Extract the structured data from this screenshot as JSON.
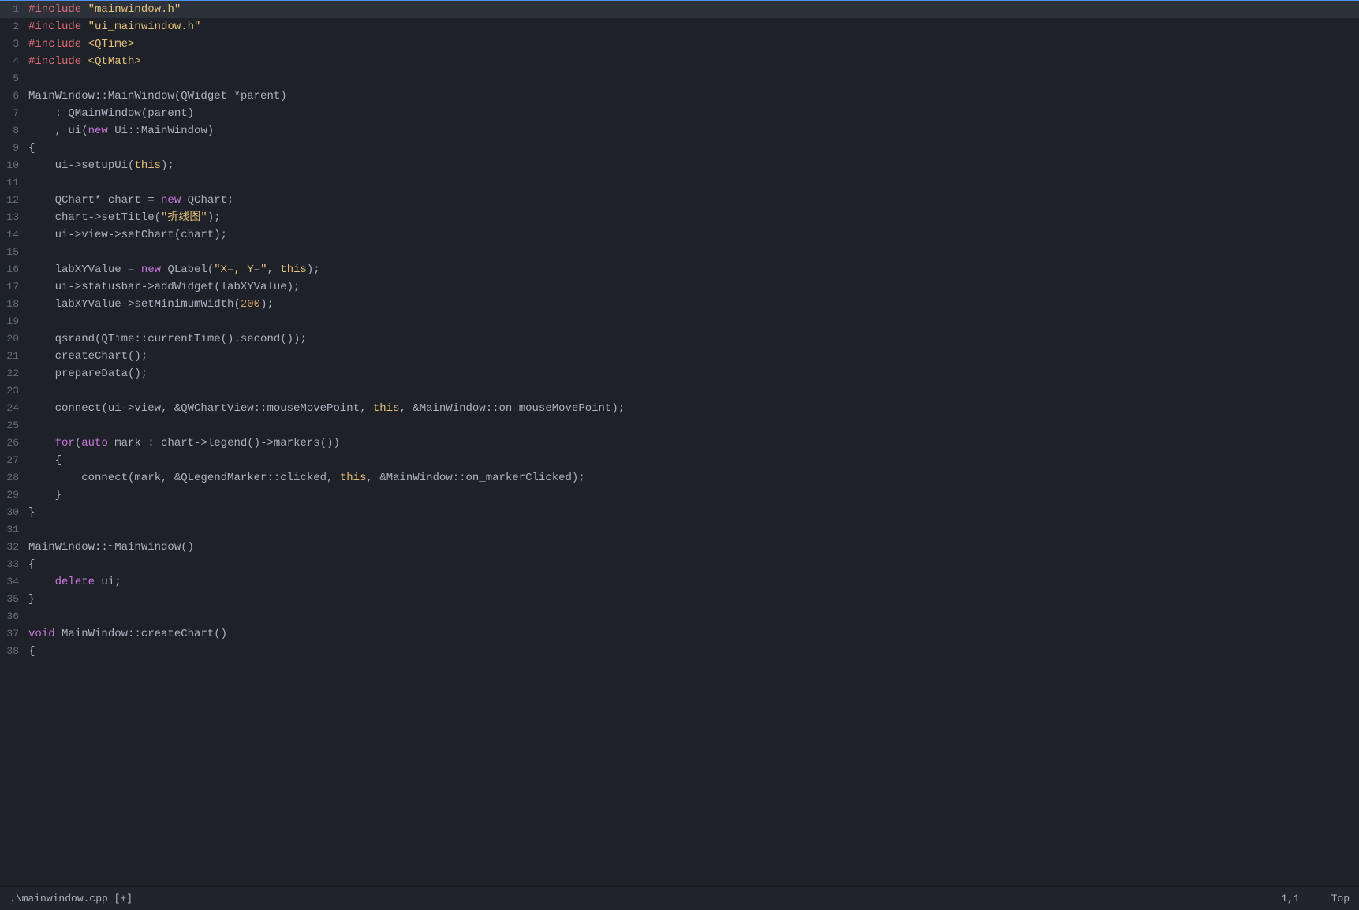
{
  "statusbar": {
    "filename": ".\\mainwindow.cpp [+]",
    "position": "1,1",
    "scroll": "Top"
  },
  "lines": [
    {
      "num": 1,
      "tokens": [
        {
          "t": "include",
          "c": "c-include"
        },
        {
          "t": " ",
          "c": ""
        },
        {
          "t": "\"mainwindow.h\"",
          "c": "c-string"
        }
      ]
    },
    {
      "num": 2,
      "tokens": [
        {
          "t": "#include",
          "c": "c-include"
        },
        {
          "t": " ",
          "c": ""
        },
        {
          "t": "\"ui_mainwindow.h\"",
          "c": "c-string"
        }
      ]
    },
    {
      "num": 3,
      "tokens": [
        {
          "t": "#include",
          "c": "c-include"
        },
        {
          "t": " ",
          "c": ""
        },
        {
          "t": "<QTime>",
          "c": "c-angle-string"
        }
      ]
    },
    {
      "num": 4,
      "tokens": [
        {
          "t": "#include",
          "c": "c-include"
        },
        {
          "t": " ",
          "c": ""
        },
        {
          "t": "<QtMath>",
          "c": "c-angle-string"
        }
      ]
    },
    {
      "num": 5,
      "tokens": []
    },
    {
      "num": 6,
      "tokens": [
        {
          "t": "MainWindow::MainWindow(QWidget *parent)",
          "c": ""
        }
      ]
    },
    {
      "num": 7,
      "tokens": [
        {
          "t": "    : QMainWindow(parent)",
          "c": ""
        }
      ]
    },
    {
      "num": 8,
      "tokens": [
        {
          "t": "    , ui(",
          "c": ""
        },
        {
          "t": "new",
          "c": "c-keyword"
        },
        {
          "t": " Ui::MainWindow)",
          "c": ""
        }
      ]
    },
    {
      "num": 9,
      "tokens": [
        {
          "t": "{",
          "c": ""
        }
      ]
    },
    {
      "num": 10,
      "tokens": [
        {
          "t": "    ui->setupUi(",
          "c": ""
        },
        {
          "t": "this",
          "c": "c-keyword2"
        },
        {
          "t": ");",
          "c": ""
        }
      ]
    },
    {
      "num": 11,
      "tokens": []
    },
    {
      "num": 12,
      "tokens": [
        {
          "t": "    QChart* chart = ",
          "c": ""
        },
        {
          "t": "new",
          "c": "c-keyword"
        },
        {
          "t": " QChart;",
          "c": ""
        }
      ]
    },
    {
      "num": 13,
      "tokens": [
        {
          "t": "    chart->setTitle(",
          "c": ""
        },
        {
          "t": "\"折线图\"",
          "c": "c-string"
        },
        {
          "t": ");",
          "c": ""
        }
      ]
    },
    {
      "num": 14,
      "tokens": [
        {
          "t": "    ui->view->setChart(chart);",
          "c": ""
        }
      ]
    },
    {
      "num": 15,
      "tokens": []
    },
    {
      "num": 16,
      "tokens": [
        {
          "t": "    labXYValue = ",
          "c": ""
        },
        {
          "t": "new",
          "c": "c-keyword"
        },
        {
          "t": " QLabel(",
          "c": ""
        },
        {
          "t": "\"X=, Y=\"",
          "c": "c-string"
        },
        {
          "t": ", ",
          "c": ""
        },
        {
          "t": "this",
          "c": "c-keyword2"
        },
        {
          "t": ");",
          "c": ""
        }
      ]
    },
    {
      "num": 17,
      "tokens": [
        {
          "t": "    ui->statusbar->addWidget(labXYValue);",
          "c": ""
        }
      ]
    },
    {
      "num": 18,
      "tokens": [
        {
          "t": "    labXYValue->setMinimumWidth(",
          "c": ""
        },
        {
          "t": "200",
          "c": "c-number"
        },
        {
          "t": ");",
          "c": ""
        }
      ]
    },
    {
      "num": 19,
      "tokens": []
    },
    {
      "num": 20,
      "tokens": [
        {
          "t": "    qsrand(QTime::currentTime().second());",
          "c": ""
        }
      ]
    },
    {
      "num": 21,
      "tokens": [
        {
          "t": "    createChart();",
          "c": ""
        }
      ]
    },
    {
      "num": 22,
      "tokens": [
        {
          "t": "    prepareData();",
          "c": ""
        }
      ]
    },
    {
      "num": 23,
      "tokens": []
    },
    {
      "num": 24,
      "tokens": [
        {
          "t": "    connect(ui->view, &QWChartView::mouseMovePoint, ",
          "c": ""
        },
        {
          "t": "this",
          "c": "c-keyword2"
        },
        {
          "t": ", &MainWindow::on_mouseMovePoint);",
          "c": ""
        }
      ]
    },
    {
      "num": 25,
      "tokens": []
    },
    {
      "num": 26,
      "tokens": [
        {
          "t": "    ",
          "c": ""
        },
        {
          "t": "for",
          "c": "c-keyword"
        },
        {
          "t": "(",
          "c": ""
        },
        {
          "t": "auto",
          "c": "c-keyword"
        },
        {
          "t": " mark : chart->legend()->markers())",
          "c": ""
        }
      ]
    },
    {
      "num": 27,
      "tokens": [
        {
          "t": "    {",
          "c": ""
        }
      ]
    },
    {
      "num": 28,
      "tokens": [
        {
          "t": "        connect(mark, &QLegendMarker::clicked, ",
          "c": ""
        },
        {
          "t": "this",
          "c": "c-keyword2"
        },
        {
          "t": ", &MainWindow::on_markerClicked);",
          "c": ""
        }
      ]
    },
    {
      "num": 29,
      "tokens": [
        {
          "t": "    }",
          "c": ""
        }
      ]
    },
    {
      "num": 30,
      "tokens": [
        {
          "t": "}",
          "c": ""
        }
      ]
    },
    {
      "num": 31,
      "tokens": []
    },
    {
      "num": 32,
      "tokens": [
        {
          "t": "MainWindow::~MainWindow()",
          "c": ""
        }
      ]
    },
    {
      "num": 33,
      "tokens": [
        {
          "t": "{",
          "c": ""
        }
      ]
    },
    {
      "num": 34,
      "tokens": [
        {
          "t": "    ",
          "c": ""
        },
        {
          "t": "delete",
          "c": "c-keyword"
        },
        {
          "t": " ui;",
          "c": ""
        }
      ]
    },
    {
      "num": 35,
      "tokens": [
        {
          "t": "}",
          "c": ""
        }
      ]
    },
    {
      "num": 36,
      "tokens": []
    },
    {
      "num": 37,
      "tokens": [
        {
          "t": "void",
          "c": "c-keyword"
        },
        {
          "t": " MainWindow::createChart()",
          "c": ""
        }
      ]
    },
    {
      "num": 38,
      "tokens": [
        {
          "t": "{",
          "c": ""
        }
      ]
    }
  ]
}
